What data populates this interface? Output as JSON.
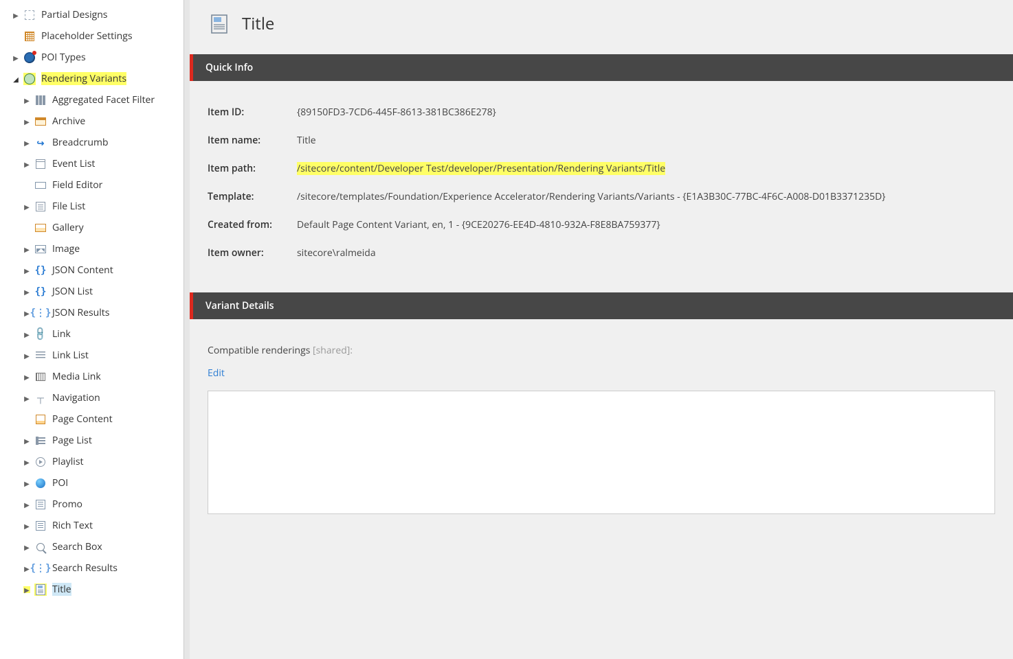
{
  "sidebar": {
    "items": [
      {
        "label": "Partial Designs",
        "icon": "box-dashed",
        "depth": 0,
        "expand": "right",
        "highlight": false
      },
      {
        "label": "Placeholder Settings",
        "icon": "grid4",
        "depth": 0,
        "expand": "none",
        "highlight": false
      },
      {
        "label": "POI Types",
        "icon": "globe-dot",
        "depth": 0,
        "expand": "right",
        "highlight": false
      },
      {
        "label": "Rendering Variants",
        "icon": "chip",
        "depth": 0,
        "expand": "down",
        "highlight": true
      },
      {
        "label": "Aggregated Facet Filter",
        "icon": "columns",
        "depth": 1,
        "expand": "right",
        "highlight": false
      },
      {
        "label": "Archive",
        "icon": "archive",
        "depth": 1,
        "expand": "right",
        "highlight": false
      },
      {
        "label": "Breadcrumb",
        "icon": "bread",
        "depth": 1,
        "expand": "right",
        "highlight": false
      },
      {
        "label": "Event List",
        "icon": "calendar",
        "depth": 1,
        "expand": "right",
        "highlight": false
      },
      {
        "label": "Field Editor",
        "icon": "rect",
        "depth": 1,
        "expand": "none",
        "highlight": false
      },
      {
        "label": "File List",
        "icon": "filelist",
        "depth": 1,
        "expand": "right",
        "highlight": false
      },
      {
        "label": "Gallery",
        "icon": "gallery",
        "depth": 1,
        "expand": "none",
        "highlight": false
      },
      {
        "label": "Image",
        "icon": "picture",
        "depth": 1,
        "expand": "right",
        "highlight": false
      },
      {
        "label": "JSON Content",
        "icon": "braces",
        "depth": 1,
        "expand": "right",
        "highlight": false
      },
      {
        "label": "JSON List",
        "icon": "braces",
        "depth": 1,
        "expand": "right",
        "highlight": false
      },
      {
        "label": "JSON Results",
        "icon": "braces-dotted",
        "depth": 1,
        "expand": "right",
        "highlight": false
      },
      {
        "label": "Link",
        "icon": "blink",
        "depth": 1,
        "expand": "right",
        "highlight": false
      },
      {
        "label": "Link List",
        "icon": "lines",
        "depth": 1,
        "expand": "right",
        "highlight": false
      },
      {
        "label": "Media Link",
        "icon": "film",
        "depth": 1,
        "expand": "right",
        "highlight": false
      },
      {
        "label": "Navigation",
        "icon": "nav",
        "depth": 1,
        "expand": "right",
        "highlight": false
      },
      {
        "label": "Page Content",
        "icon": "pagecontent",
        "depth": 1,
        "expand": "none",
        "highlight": false
      },
      {
        "label": "Page List",
        "icon": "pagelist",
        "depth": 1,
        "expand": "right",
        "highlight": false
      },
      {
        "label": "Playlist",
        "icon": "playlist",
        "depth": 1,
        "expand": "right",
        "highlight": false
      },
      {
        "label": "POI",
        "icon": "poi",
        "depth": 1,
        "expand": "right",
        "highlight": false
      },
      {
        "label": "Promo",
        "icon": "promo",
        "depth": 1,
        "expand": "right",
        "highlight": false
      },
      {
        "label": "Rich Text",
        "icon": "promo",
        "depth": 1,
        "expand": "right",
        "highlight": false
      },
      {
        "label": "Search Box",
        "icon": "search",
        "depth": 1,
        "expand": "right",
        "highlight": false
      },
      {
        "label": "Search Results",
        "icon": "braces-dotted",
        "depth": 1,
        "expand": "right",
        "highlight": false
      },
      {
        "label": "Title",
        "icon": "doc",
        "depth": 1,
        "expand": "right",
        "highlight": true,
        "selected": true
      }
    ]
  },
  "content": {
    "title": "Title",
    "sections": {
      "quick_info": {
        "header": "Quick Info",
        "rows": [
          {
            "label": "Item ID:",
            "value": "{89150FD3-7CD6-445F-8613-381BC386E278}",
            "highlight": false
          },
          {
            "label": "Item name:",
            "value": "Title",
            "highlight": false
          },
          {
            "label": "Item path:",
            "value": "/sitecore/content/Developer Test/developer/Presentation/Rendering Variants/Title",
            "highlight": true
          },
          {
            "label": "Template:",
            "value": "/sitecore/templates/Foundation/Experience Accelerator/Rendering Variants/Variants - {E1A3B30C-77BC-4F6C-A008-D01B3371235D}",
            "highlight": false
          },
          {
            "label": "Created from:",
            "value": "Default Page Content Variant, en, 1 - {9CE20276-EE4D-4810-932A-F8E8BA759377}",
            "highlight": false
          },
          {
            "label": "Item owner:",
            "value": "sitecore\\ralmeida",
            "highlight": false
          }
        ]
      },
      "variant_details": {
        "header": "Variant Details",
        "compat_label": "Compatible renderings ",
        "compat_shared": "[shared]:",
        "edit_link": "Edit"
      }
    }
  }
}
